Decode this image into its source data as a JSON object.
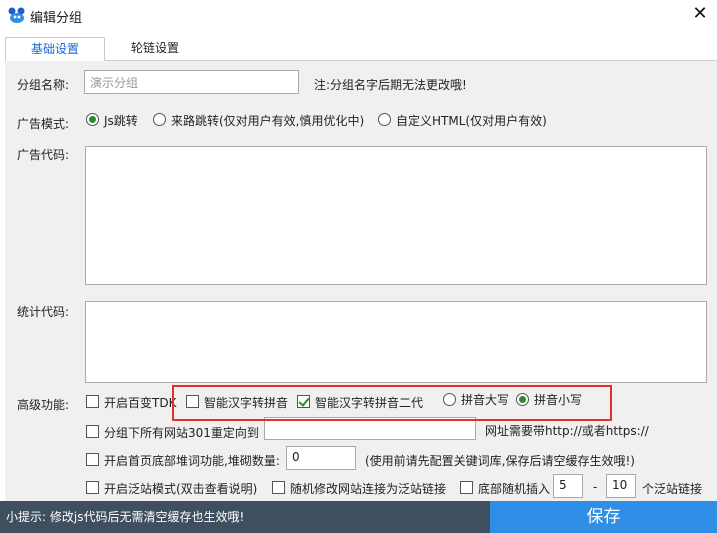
{
  "window": {
    "title": "编辑分组",
    "close_glyph": "✕"
  },
  "tabs": [
    {
      "label": "基础设置",
      "active": true
    },
    {
      "label": "轮链设置",
      "active": false
    }
  ],
  "form": {
    "group_name_label": "分组名称:",
    "group_name_value": "演示分组",
    "group_name_note": "注:分组名字后期无法更改哦!",
    "ad_mode_label": "广告模式:",
    "ad_mode_options": [
      {
        "label": "Js跳转",
        "selected": true
      },
      {
        "label": "来路跳转(仅对用户有效,慎用优化中)",
        "selected": false
      },
      {
        "label": "自定义HTML(仅对用户有效)",
        "selected": false
      }
    ],
    "ad_code_label": "广告代码:",
    "ad_code_value": "",
    "stats_code_label": "统计代码:",
    "stats_code_value": "",
    "advanced_label": "高级功能:",
    "adv_row1": [
      {
        "label": "开启百变TDK",
        "checked": false
      },
      {
        "label": "智能汉字转拼音",
        "checked": false
      },
      {
        "label": "智能汉字转拼音二代",
        "checked": true
      }
    ],
    "pinyin_case": [
      {
        "label": "拼音大写",
        "selected": false
      },
      {
        "label": "拼音小写",
        "selected": true
      }
    ],
    "redirect301_label": "分组下所有网站301重定向到",
    "redirect301_value": "",
    "redirect301_note": "网址需要带http://或者https://",
    "footer_words_label": "开启首页底部堆词功能,堆砌数量:",
    "footer_words_value": "0",
    "footer_words_note": "(使用前请先配置关键词库,保存后请空缓存生效哦!)",
    "pan_mode_label": "开启泛站模式(双击查看说明)",
    "pan_mode_checked": false,
    "random_link_label": "随机修改网站连接为泛站链接",
    "random_link_checked": false,
    "footer_random_label": "底部随机插入",
    "footer_random_checked": false,
    "footer_random_min": "5",
    "footer_random_dash": "-",
    "footer_random_max": "10",
    "footer_random_suffix": "个泛站链接"
  },
  "bottom": {
    "tip": "小提示: 修改js代码后无需清空缓存也生效哦!",
    "save_label": "保存"
  },
  "colors": {
    "tip_bg": "#3f4f5f",
    "save_bg": "#2f8ee6",
    "highlight_box": "#e53030",
    "active_tab_text": "#1a66d6"
  }
}
